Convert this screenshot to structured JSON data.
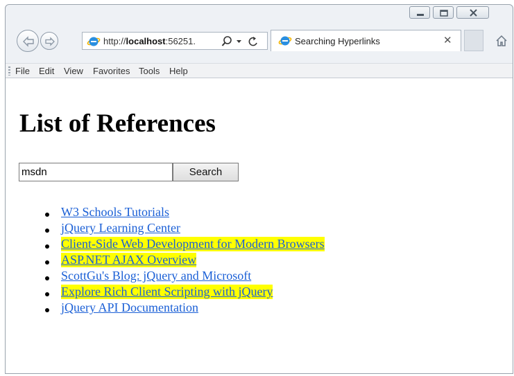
{
  "browser": {
    "address_prefix": "http://",
    "address_host": "localhost",
    "address_port": ":56251.",
    "tab_title": "Searching Hyperlinks",
    "tab_close": "✕"
  },
  "menu": [
    "File",
    "Edit",
    "View",
    "Favorites",
    "Tools",
    "Help"
  ],
  "page": {
    "title": "List of References",
    "search": {
      "value": "msdn",
      "button_label": "Search"
    },
    "links": [
      {
        "label": "W3 Schools Tutorials",
        "highlighted": false
      },
      {
        "label": "jQuery Learning Center",
        "highlighted": false
      },
      {
        "label": "Client-Side Web Development for Modern Browsers",
        "highlighted": true
      },
      {
        "label": "ASP.NET AJAX Overview",
        "highlighted": true
      },
      {
        "label": "ScottGu's Blog: jQuery and Microsoft",
        "highlighted": false
      },
      {
        "label": "Explore Rich Client Scripting with jQuery",
        "highlighted": true
      },
      {
        "label": "jQuery API Documentation",
        "highlighted": false
      }
    ]
  },
  "colors": {
    "link": "#1a5fd6",
    "highlight": "#ffff00",
    "ie_logo": "#2a8fe0"
  },
  "icons": [
    "minimize-icon",
    "restore-icon",
    "close-icon",
    "back-arrow-icon",
    "forward-arrow-icon",
    "ie-logo-icon",
    "search-icon",
    "dropdown-icon",
    "refresh-icon",
    "home-icon"
  ]
}
